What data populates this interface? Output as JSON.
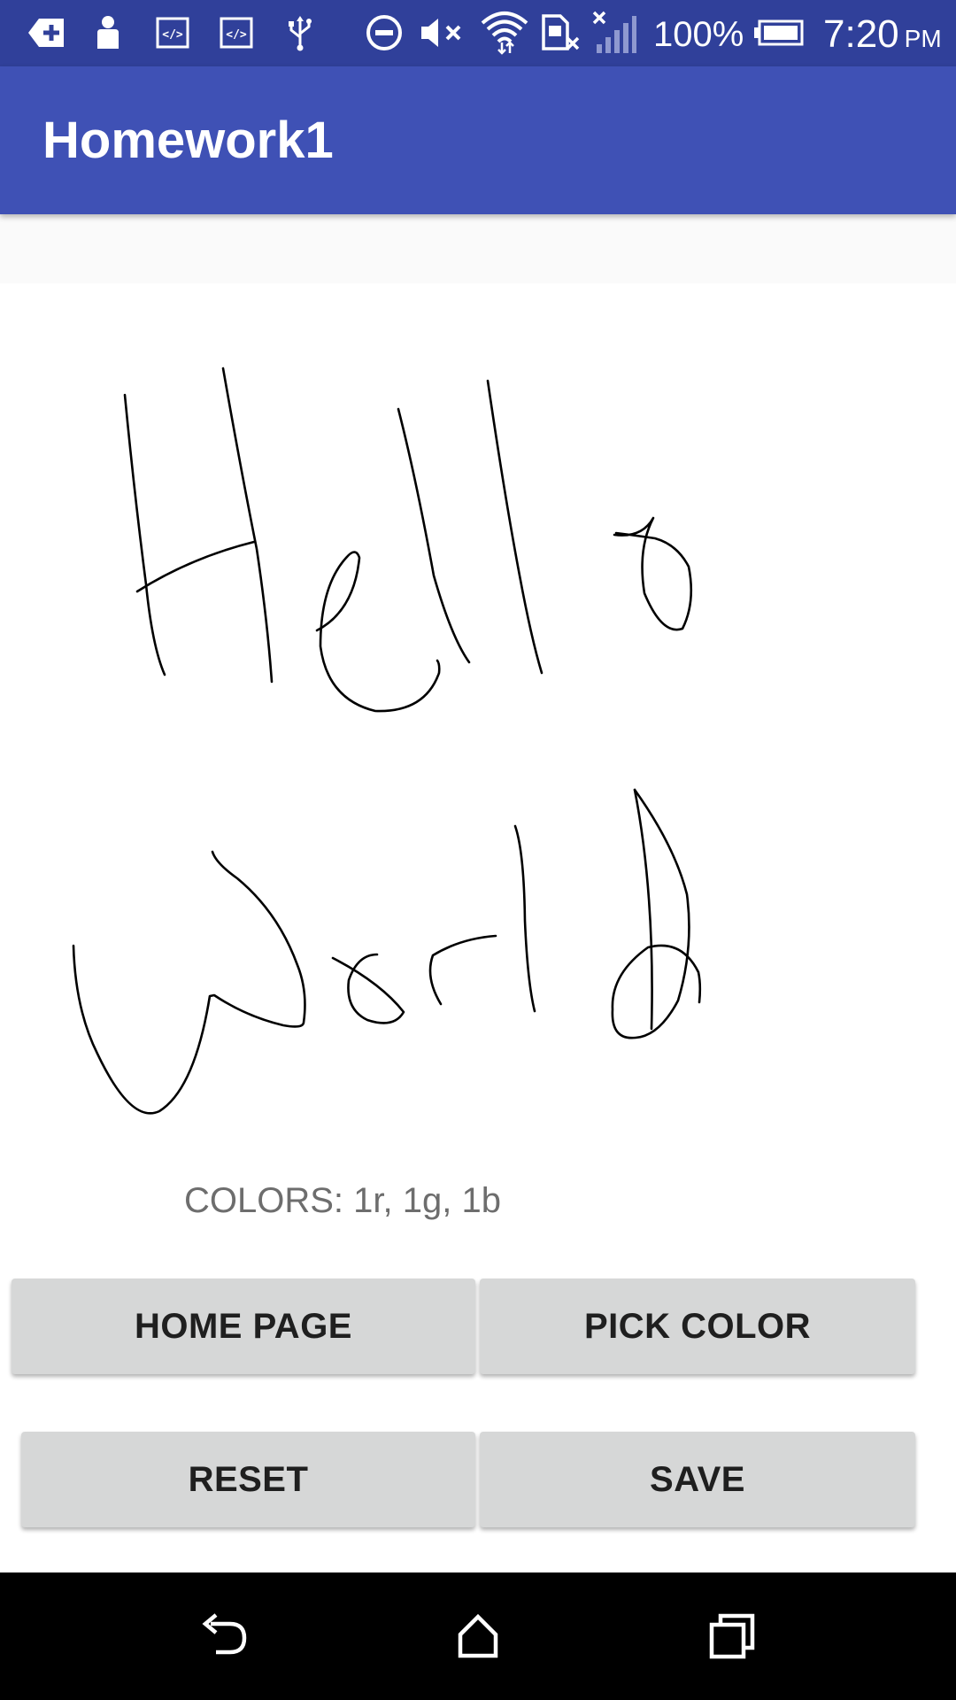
{
  "status_bar": {
    "battery_percent": "100%",
    "clock_time": "7:20",
    "clock_ampm": "PM",
    "icons": [
      "add-notification-icon",
      "person-icon",
      "code-icon",
      "code-icon",
      "usb-icon",
      "do-not-disturb-icon",
      "volume-muted-icon",
      "wifi-icon",
      "no-sim-icon",
      "signal-no-service-icon",
      "battery-icon"
    ]
  },
  "app_bar": {
    "title": "Homework1",
    "color": "#3f51b5",
    "status_color": "#30409a"
  },
  "canvas": {
    "drawing_text": "Hello World",
    "stroke_color": "#000000"
  },
  "colors_label": "COLORS: 1r, 1g, 1b",
  "buttons": {
    "home_page": "HOME PAGE",
    "pick_color": "PICK COLOR",
    "reset": "RESET",
    "save": "SAVE"
  },
  "nav_bar": {
    "icons": [
      "back-icon",
      "home-icon",
      "recents-icon"
    ]
  }
}
